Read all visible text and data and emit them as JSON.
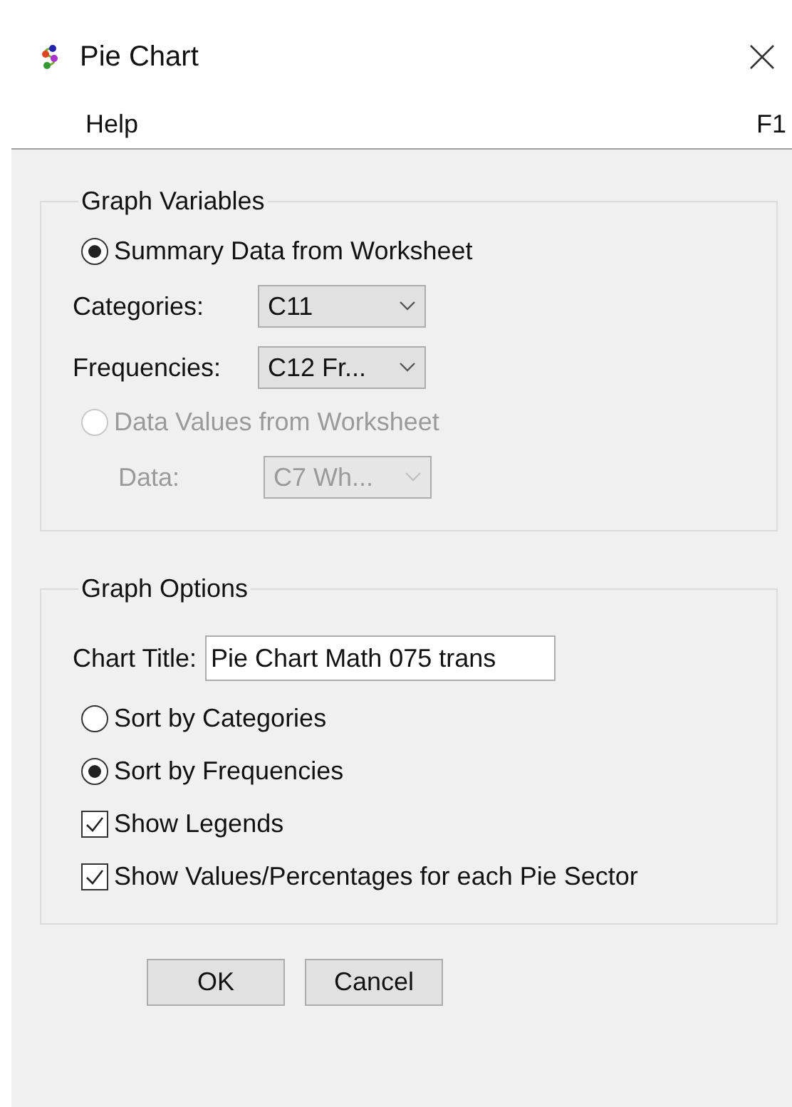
{
  "window": {
    "title": "Pie Chart"
  },
  "menu": {
    "label": "Help",
    "shortcut": "F1"
  },
  "graph_variables": {
    "title": "Graph Variables",
    "source_options": [
      {
        "label": "Summary Data from Worksheet",
        "selected": true,
        "disabled": false,
        "fields": [
          {
            "label": "Categories:",
            "value": "C11",
            "disabled": false
          },
          {
            "label": "Frequencies:",
            "value": "C12  Fr...",
            "disabled": false
          }
        ]
      },
      {
        "label": "Data Values from Worksheet",
        "selected": false,
        "disabled": true,
        "fields": [
          {
            "label": "Data:",
            "value": "C7  Wh...",
            "disabled": true
          }
        ]
      }
    ]
  },
  "graph_options": {
    "title": "Graph Options",
    "chart_title": {
      "label": "Chart Title:",
      "value": "Pie Chart Math 075 trans"
    },
    "sort_options": [
      {
        "label": "Sort by Categories",
        "selected": false
      },
      {
        "label": "Sort by Frequencies",
        "selected": true
      }
    ],
    "checkboxes": [
      {
        "label": "Show Legends",
        "checked": true
      },
      {
        "label": "Show Values/Percentages for each Pie Sector",
        "checked": true
      }
    ]
  },
  "buttons": [
    "OK",
    "Cancel"
  ]
}
